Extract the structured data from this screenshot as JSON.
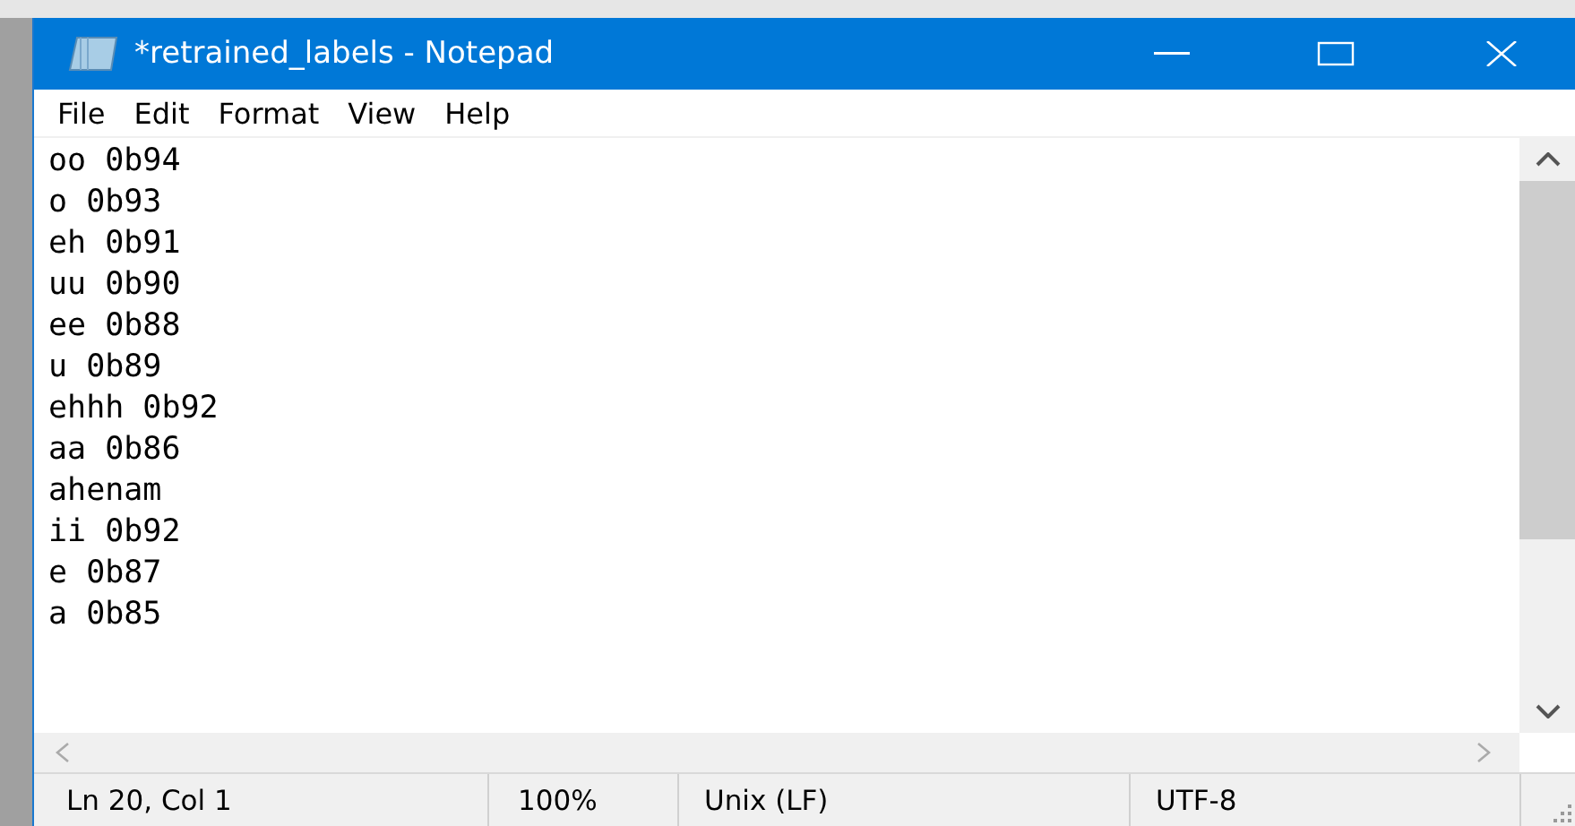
{
  "window": {
    "title": "*retrained_labels - Notepad"
  },
  "menu": [
    "File",
    "Edit",
    "Format",
    "View",
    "Help"
  ],
  "editor": {
    "lines": [
      "oo 0b94",
      "o 0b93",
      "eh 0b91",
      "uu 0b90",
      "ee 0b88",
      "u 0b89",
      "ehhh 0b92",
      "aa 0b86",
      "ahenam",
      "ii 0b92",
      "e 0b87",
      "a 0b85"
    ]
  },
  "status_bar": [
    "Ln 20, Col 1",
    "100%",
    "Unix (LF)",
    "UTF-8"
  ]
}
